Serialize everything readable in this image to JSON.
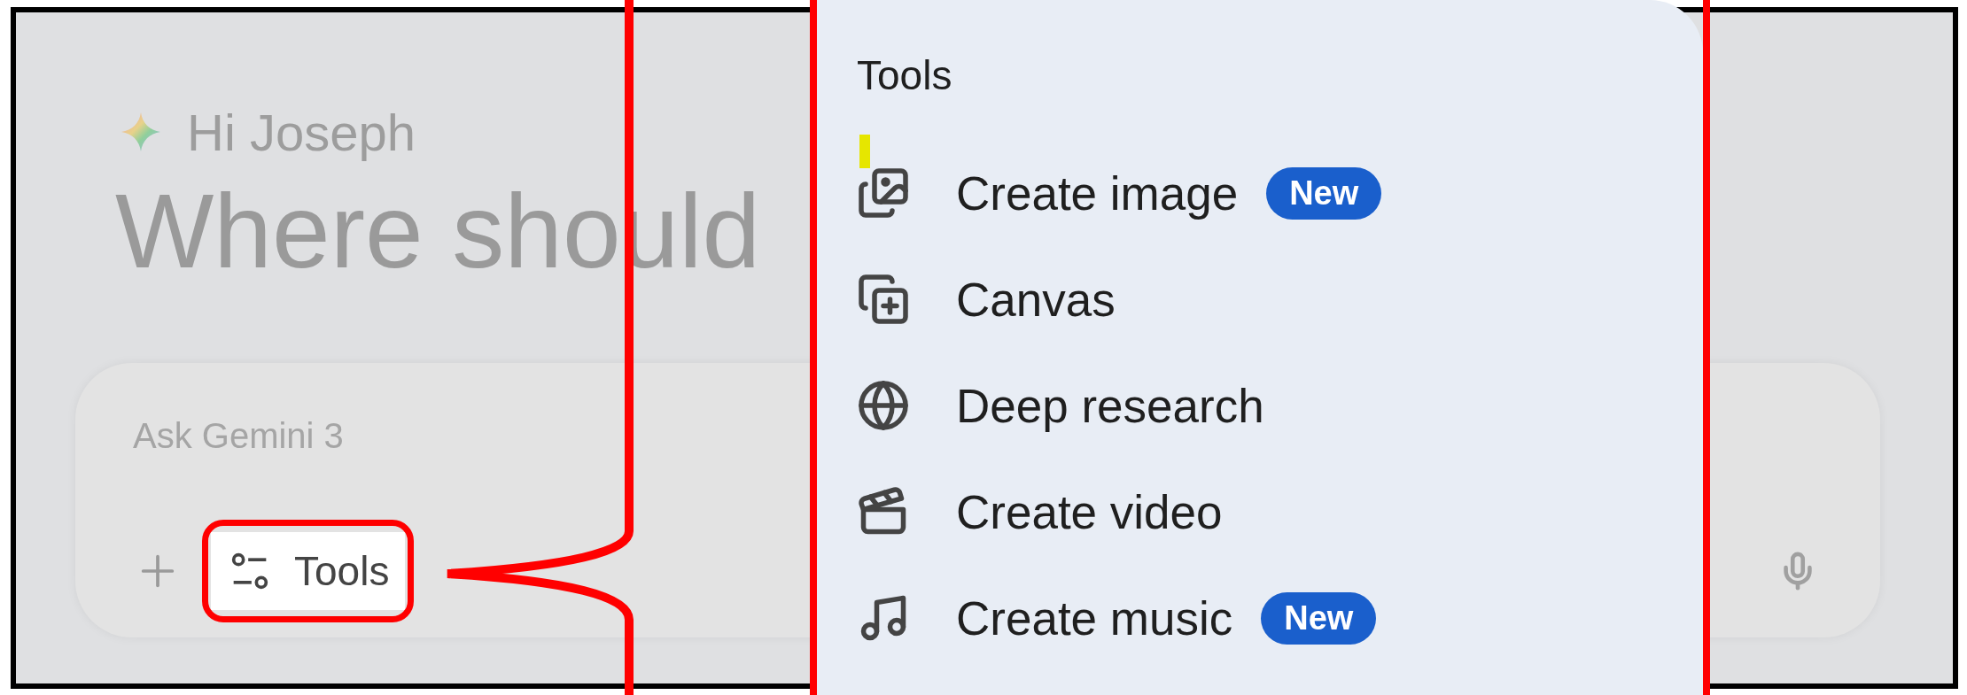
{
  "greeting": "Hi Joseph",
  "headline": "Where should",
  "prompt": {
    "placeholder": "Ask Gemini 3",
    "tools_button": "Tools"
  },
  "menu": {
    "title": "Tools",
    "items": [
      {
        "kind": "image",
        "label": "Create image",
        "badge": "New"
      },
      {
        "kind": "canvas",
        "label": "Canvas"
      },
      {
        "kind": "research",
        "label": "Deep research"
      },
      {
        "kind": "video",
        "label": "Create video"
      },
      {
        "kind": "music",
        "label": "Create music",
        "badge": "New"
      }
    ]
  }
}
